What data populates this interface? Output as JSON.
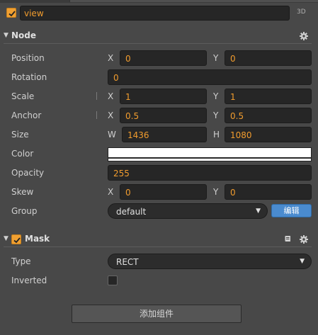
{
  "node_name": {
    "enabled": true,
    "value": "view",
    "mode_badge": "3D"
  },
  "node_section": {
    "title": "Node",
    "expanded": true,
    "settings_icon": "gear-icon",
    "position": {
      "x_label": "X",
      "x": "0",
      "y_label": "Y",
      "y": "0",
      "label": "Position"
    },
    "rotation": {
      "label": "Rotation",
      "value": "0"
    },
    "scale": {
      "label": "Scale",
      "x_label": "X",
      "x": "1",
      "y_label": "Y",
      "y": "1"
    },
    "anchor": {
      "label": "Anchor",
      "x_label": "X",
      "x": "0.5",
      "y_label": "Y",
      "y": "0.5"
    },
    "size": {
      "label": "Size",
      "w_label": "W",
      "w": "1436",
      "h_label": "H",
      "h": "1080"
    },
    "color": {
      "label": "Color",
      "value": "#ffffff"
    },
    "opacity": {
      "label": "Opacity",
      "value": "255"
    },
    "skew": {
      "label": "Skew",
      "x_label": "X",
      "x": "0",
      "y_label": "Y",
      "y": "0"
    },
    "group": {
      "label": "Group",
      "value": "default",
      "edit_label": "编辑"
    }
  },
  "mask_section": {
    "title": "Mask",
    "expanded": true,
    "enabled": true,
    "doc_icon": "book-icon",
    "settings_icon": "gear-icon",
    "type": {
      "label": "Type",
      "value": "RECT"
    },
    "inverted": {
      "label": "Inverted",
      "checked": false
    }
  },
  "add_component_label": "添加组件",
  "colors": {
    "panel_bg": "#484848",
    "field_bg": "#262626",
    "value_orange": "#f19c2e",
    "accent_blue": "#4a8bcf",
    "checkbox_orange": "#f0a032"
  }
}
